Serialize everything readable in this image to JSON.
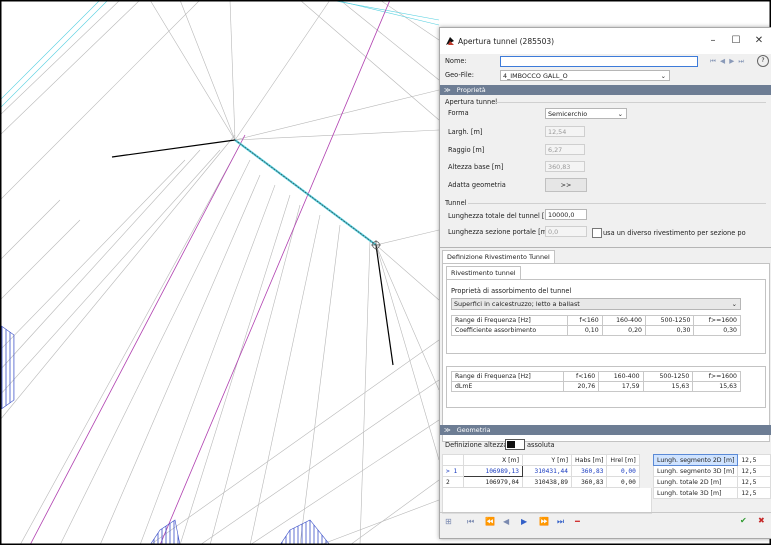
{
  "dialog": {
    "title": "Apertura tunnel (285503)",
    "controls": {
      "minimize": "–",
      "maximize": "☐",
      "close": "✕"
    },
    "name_label": "Nome:",
    "name_value": "",
    "geofile_label": "Geo-File:",
    "geofile_value": "4_IMBOCCO GALL_O",
    "nav_glyphs": "⏮ ◀ ▶ ⏭",
    "help_glyph": "?"
  },
  "proprieta": {
    "section_label": "Proprietà",
    "apertura_group": "Apertura tunnel",
    "forma_label": "Forma",
    "forma_value": "Semicerchio",
    "largh_label": "Largh. [m]",
    "largh_value": "12,54",
    "raggio_label": "Raggio [m]",
    "raggio_value": "6,27",
    "altezza_label": "Altezza base [m]",
    "altezza_value": "360,83",
    "adatta_label": "Adatta geometria",
    "adatta_button": ">>",
    "tunnel_group": "Tunnel",
    "lung_tot_label": "Lunghezza totale del tunnel [m]",
    "lung_tot_value": "10000,0",
    "lung_sez_label": "Lunghezza sezione portale [m]",
    "lung_sez_value": "0,0",
    "diverso_label": "usa un diverso rivestimento per sezione po"
  },
  "rivestimento": {
    "outer_tab": "Definizione Rivestimento Tunnel",
    "inner_tab": "Rivestimento tunnel",
    "prop_label": "Proprietà di assorbimento del tunnel",
    "surface_value": "Superfici in calcestruzzo; letto a ballast",
    "freq_header": [
      "Range di Frequenza [Hz]",
      "f<160",
      "160-400",
      "500-1250",
      "f>=1600"
    ],
    "coef_row": [
      "Coefficiente assorbimento",
      "0,10",
      "0,20",
      "0,30",
      "0,30"
    ],
    "dl_header": [
      "Range di Frequenza [Hz]",
      "f<160",
      "160-400",
      "500-1250",
      "f>=1600"
    ],
    "dl_row": [
      "dLmE",
      "20,76",
      "17,59",
      "15,63",
      "15,63"
    ]
  },
  "geometria": {
    "section_label": "Geometria",
    "def_altezza_label": "Definizione altezza",
    "def_altezza_value": "assoluta",
    "columns": [
      "X [m]",
      "Y [m]",
      "Habs [m]",
      "Hrel [m]"
    ],
    "rows": [
      {
        "idx": "> 1",
        "x": "106989,13",
        "y": "310431,44",
        "habs": "360,83",
        "hrel": "0,00"
      },
      {
        "idx": "2",
        "x": "106979,04",
        "y": "310438,89",
        "habs": "360,83",
        "hrel": "0,00"
      }
    ],
    "summary": [
      {
        "label": "Lungh. segmento 2D [m]",
        "value": "12,5"
      },
      {
        "label": "Lungh. segmento 3D [m]",
        "value": "12,5"
      },
      {
        "label": "Lungh. totale 2D [m]",
        "value": "12,5"
      },
      {
        "label": "Lungh. totale 3D [m]",
        "value": "12,5"
      }
    ]
  },
  "toolbar": {
    "glyphs": [
      "⊞",
      "⏮",
      "⏪",
      "◀",
      "▶",
      "⏩",
      "⏭",
      "━"
    ],
    "ok": "✔",
    "cancel": "✖"
  },
  "colors": {
    "accent": "#6d7d94",
    "selection": "#cfe3ff",
    "map_line": "#b0b0b0",
    "map_cyan": "#55d0e0",
    "map_magenta": "#b040b0",
    "hatch_blue": "#3a4fc8"
  }
}
